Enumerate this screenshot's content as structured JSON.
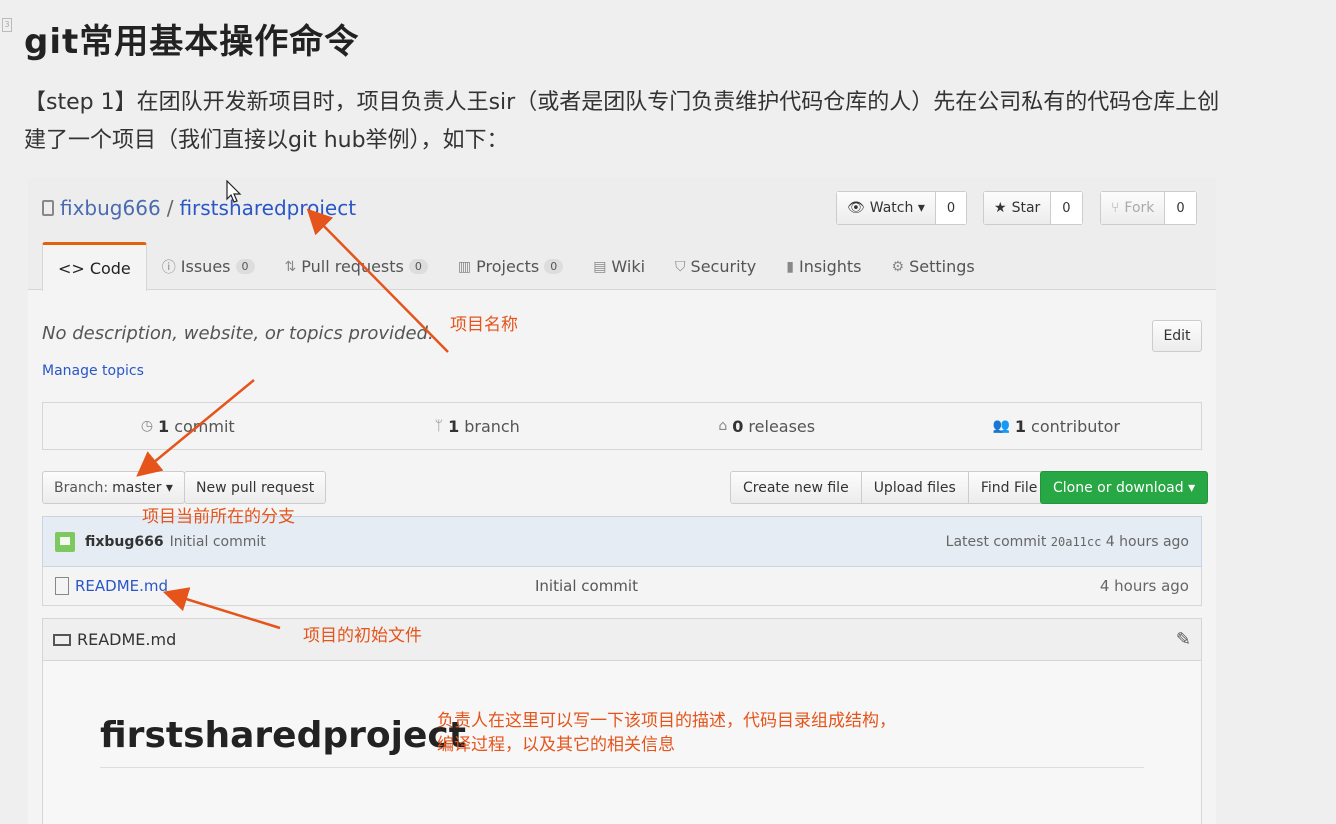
{
  "doc": {
    "title": "git常用基本操作命令",
    "paragraph": "【step 1】在团队开发新项目时，项目负责人王sir（或者是团队专门负责维护代码仓库的人）先在公司私有的代码仓库上创建了一个项目（我们直接以git hub举例），如下："
  },
  "repo": {
    "owner": "fixbug666",
    "separator": "/",
    "name": "firstsharedproject"
  },
  "header_buttons": {
    "watch": {
      "label": "Watch ▾",
      "count": "0"
    },
    "star": {
      "label": "Star",
      "count": "0"
    },
    "fork": {
      "label": "Fork",
      "count": "0"
    }
  },
  "tabs": [
    {
      "label": "Code",
      "badge": null
    },
    {
      "label": "Issues",
      "badge": "0"
    },
    {
      "label": "Pull requests",
      "badge": "0"
    },
    {
      "label": "Projects",
      "badge": "0"
    },
    {
      "label": "Wiki",
      "badge": null
    },
    {
      "label": "Security",
      "badge": null
    },
    {
      "label": "Insights",
      "badge": null
    },
    {
      "label": "Settings",
      "badge": null
    }
  ],
  "about": {
    "description": "No description, website, or topics provided.",
    "manage_topics": "Manage topics",
    "edit": "Edit"
  },
  "summary": {
    "commits_num": "1",
    "commits_label": "commit",
    "branches_num": "1",
    "branches_label": "branch",
    "releases_num": "0",
    "releases_label": "releases",
    "contributors_num": "1",
    "contributors_label": "contributor"
  },
  "toolbar": {
    "branch_label": "Branch:",
    "branch_value": "master ▾",
    "new_pr": "New pull request",
    "create_file": "Create new file",
    "upload": "Upload files",
    "find": "Find File",
    "clone": "Clone or download ▾"
  },
  "commit": {
    "user": "fixbug666",
    "message": "Initial commit",
    "latest_label": "Latest commit",
    "hash": "20a11cc",
    "age": "4 hours ago"
  },
  "files": [
    {
      "name": "README.md",
      "message": "Initial commit",
      "age": "4 hours ago"
    }
  ],
  "readme": {
    "header": "README.md",
    "heading": "firstsharedproject"
  },
  "annotations": {
    "project_name": "项目名称",
    "current_branch": "项目当前所在的分支",
    "initial_file": "项目的初始文件",
    "readme_note_1": "负责人在这里可以写一下该项目的描述，代码目录组成结构，",
    "readme_note_2": "编译过程，以及其它的相关信息"
  },
  "colors": {
    "annotation": "#e5541b",
    "link": "#2a56c6",
    "clone_button": "#28a745",
    "active_tab_border": "#e36209"
  }
}
